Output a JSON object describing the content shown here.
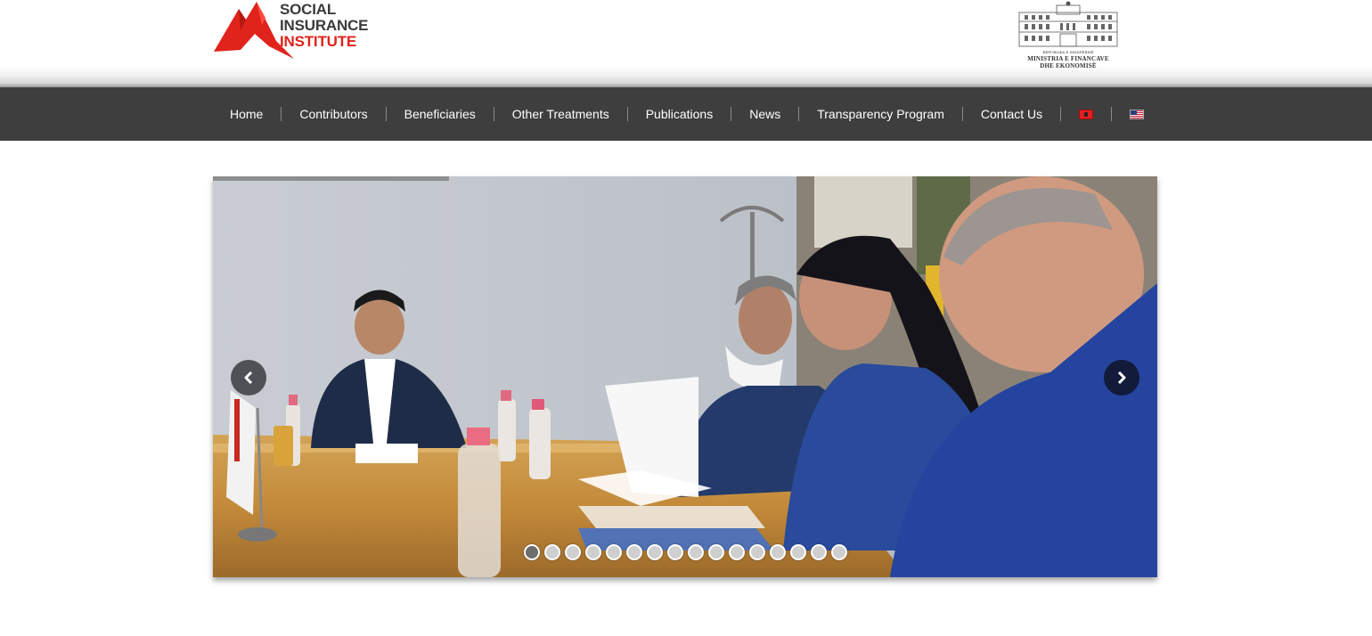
{
  "header": {
    "logo": {
      "line1": "SOCIAL",
      "line2": "INSURANCE",
      "line3": "INSTITUTE"
    },
    "ministry": {
      "small": "REPUBLIKA E SHQIPËRISË",
      "line1": "MINISTRIA E FINANCAVE",
      "line2": "DHE EKONOMISË"
    }
  },
  "nav": {
    "items": [
      "Home",
      "Contributors",
      "Beneficiaries",
      "Other Treatments",
      "Publications",
      "News",
      "Transparency Program",
      "Contact Us"
    ],
    "flags": [
      "albanian-flag-icon",
      "us-flag-icon"
    ]
  },
  "slider": {
    "progress": 0.25,
    "slide_count": 16,
    "active_slide": 1,
    "prev_icon": "chevron-left-icon",
    "next_icon": "chevron-right-icon"
  },
  "colors": {
    "brand_red": "#e0231b",
    "nav_bg": "#3e3e3e",
    "logo_gray": "#3b3b3b"
  }
}
